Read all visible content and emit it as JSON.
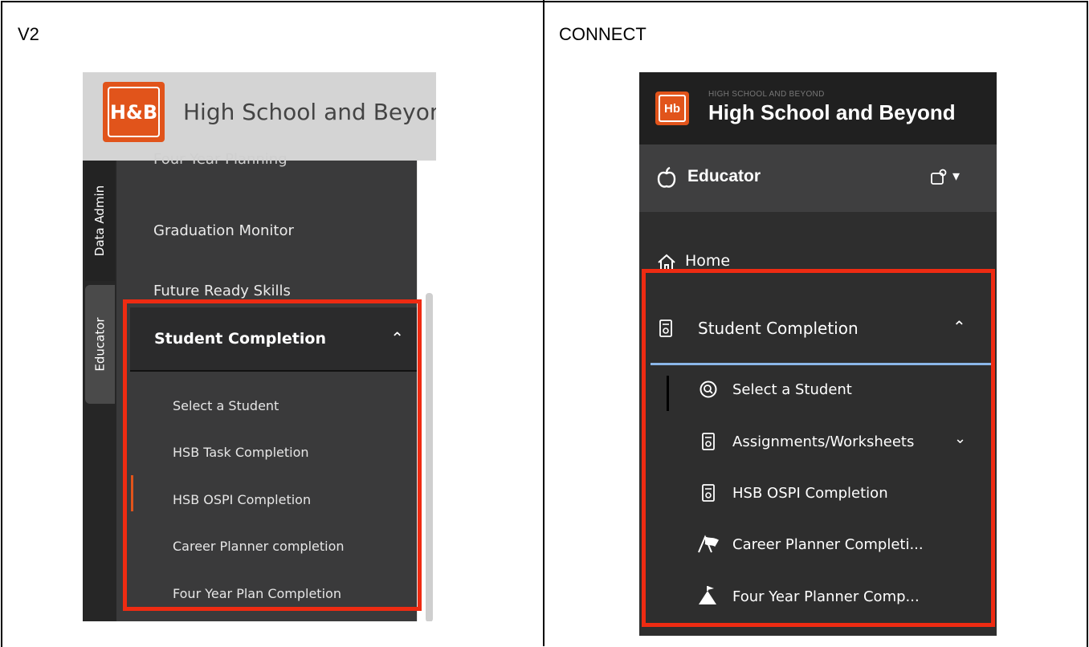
{
  "columns": {
    "left_title": "V2",
    "right_title": "CONNECT"
  },
  "v2": {
    "logo_text": "H&B",
    "brand": "High School and Beyond",
    "tabs": [
      "Data Admin",
      "Educator"
    ],
    "menu": {
      "partial_item": "Four Year Planning",
      "items": [
        "Graduation Monitor",
        "Future Ready Skills"
      ],
      "expanded_section": "Student Completion",
      "sub_items": [
        "Select a Student",
        "HSB Task Completion",
        "HSB OSPI Completion",
        "Career Planner completion",
        "Four Year Plan Completion"
      ],
      "active_sub_item": "HSB OSPI Completion"
    },
    "accent_color": "#e1541b"
  },
  "connect": {
    "logo_text": "Hb",
    "brand_small": "HIGH SCHOOL AND BEYOND",
    "brand": "High School and Beyond",
    "role": "Educator",
    "menu": {
      "home": "Home",
      "expanded_section": "Student Completion",
      "sub_items": [
        {
          "label": "Select a Student",
          "icon": "search-circle-icon"
        },
        {
          "label": "Assignments/Worksheets",
          "icon": "worksheet-icon"
        },
        {
          "label": "HSB OSPI Completion",
          "icon": "worksheet-icon"
        },
        {
          "label": "Career Planner Completi...",
          "icon": "career-planner-icon"
        },
        {
          "label": "Four Year Planner Comp...",
          "icon": "mountain-flag-icon"
        }
      ],
      "active_sub_item": "Select a Student"
    },
    "highlight_color": "#ee2b12"
  }
}
